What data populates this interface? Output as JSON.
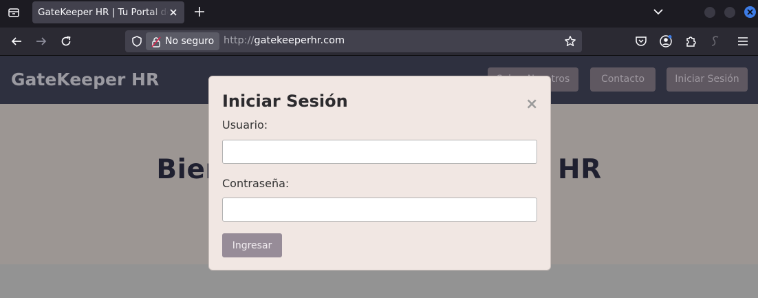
{
  "browser": {
    "tab_title": "GateKeeper HR | Tu Portal de Recursos Humanos",
    "security_label": "No seguro",
    "url_protocol": "http://",
    "url_domain": "gatekeeperhr.com",
    "accent_color": "#3d7ce6"
  },
  "site": {
    "logo": "GateKeeper HR",
    "nav": [
      "Sobre Nosotros",
      "Contacto",
      "Iniciar Sesión"
    ],
    "hero_title": "Bienvenido a GateKeeper HR"
  },
  "modal": {
    "title": "Iniciar Sesión",
    "close": "×",
    "username_label": "Usuario:",
    "username_value": "",
    "password_label": "Contraseña:",
    "password_value": "",
    "submit": "Ingresar"
  }
}
